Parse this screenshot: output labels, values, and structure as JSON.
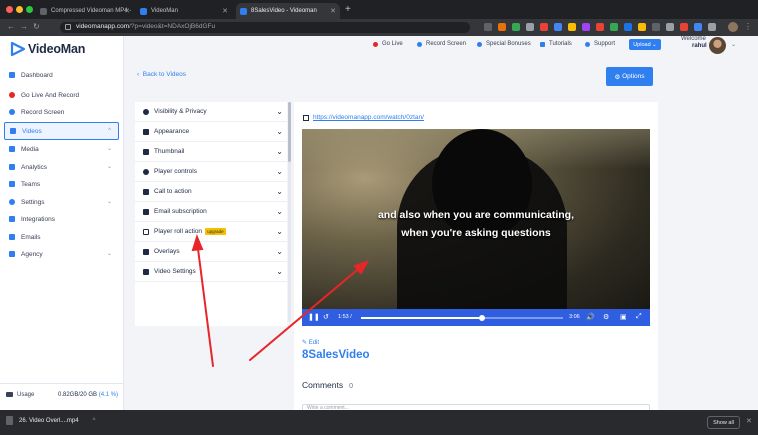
{
  "browser": {
    "tabs": [
      {
        "title": "Compressed Videoman MP4 -"
      },
      {
        "title": "VideoMan"
      },
      {
        "title": "8SalesVideo - Videoman"
      }
    ],
    "url_host": "videomanapp.com",
    "url_path": "/?p=video&t=NDAxOjB6dGFu"
  },
  "app": {
    "logo_text": "VideoMan",
    "sidebar": {
      "items": [
        {
          "label": "Dashboard"
        },
        {
          "label": "Go Live And Record"
        },
        {
          "label": "Record Screen"
        },
        {
          "label": "Videos"
        },
        {
          "label": "Media"
        },
        {
          "label": "Analytics"
        },
        {
          "label": "Teams"
        },
        {
          "label": "Settings"
        },
        {
          "label": "Integrations"
        },
        {
          "label": "Emails"
        },
        {
          "label": "Agency"
        }
      ],
      "usage_label": "Usage",
      "usage_value": "0.82GB/20 GB",
      "usage_percent": "(4.1 %)"
    },
    "topnav": {
      "go_live": "Go Live",
      "record_screen": "Record Screen",
      "special_bonuses": "Special Bonuses",
      "tutorials": "Tutorials",
      "support": "Support",
      "upload": "Upload",
      "welcome": "Welcome",
      "username": "rahul"
    },
    "back_link": "Back to Videos",
    "options_button": "Options",
    "settings": {
      "rows": [
        {
          "label": "Visibility & Privacy"
        },
        {
          "label": "Appearance"
        },
        {
          "label": "Thumbnail"
        },
        {
          "label": "Player controls"
        },
        {
          "label": "Call to action"
        },
        {
          "label": "Email subscription"
        },
        {
          "label": "Player roll action",
          "badge": "upgrade"
        },
        {
          "label": "Overlays"
        },
        {
          "label": "Video Settings"
        }
      ]
    },
    "video": {
      "watch_url": "https://videomanapp.com/watch/0ztan/",
      "caption_line1": "and also when you are communicating,",
      "caption_line2": "when you're asking questions",
      "current_time": "1:53 /",
      "duration": "3:06",
      "progress": 0.6,
      "edit_label": "Edit",
      "title": "8SalesVideo",
      "comments_label": "Comments",
      "comments_count": "0",
      "comment_placeholder": "Write a comment..."
    }
  },
  "downloads": {
    "file": "26. Video Overl....mp4",
    "show_all": "Show all"
  },
  "colors": {
    "accent": "#2f7ff0",
    "player_bar": "#2f5fe0",
    "badge": "#f6c000",
    "annotation": "#e8262a"
  }
}
